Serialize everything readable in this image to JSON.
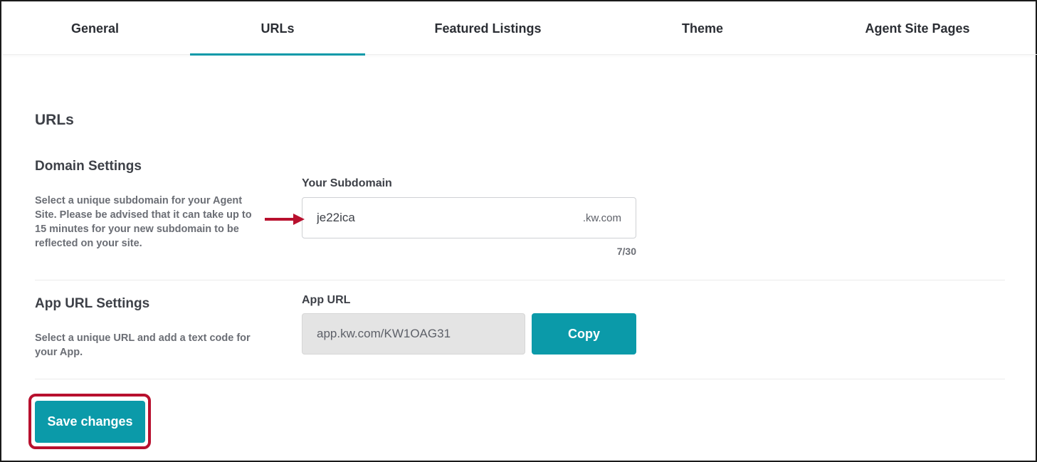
{
  "tabs": [
    {
      "label": "General",
      "active": false
    },
    {
      "label": "URLs",
      "active": true
    },
    {
      "label": "Featured Listings",
      "active": false
    },
    {
      "label": "Theme",
      "active": false
    },
    {
      "label": "Agent Site Pages",
      "active": false
    }
  ],
  "main": {
    "title": "URLs",
    "domain": {
      "title": "Domain Settings",
      "description": "Select a unique subdomain for your Agent Site. Please be advised that it can take up to 15 minutes for your new subdomain to be reflected on your site.",
      "field_label": "Your Subdomain",
      "value": "je22ica",
      "suffix": ".kw.com",
      "counter": "7/30"
    },
    "app_url": {
      "title": "App URL Settings",
      "description": "Select a unique URL and add a text code for your App.",
      "field_label": "App URL",
      "value": "app.kw.com/KW1OAG31",
      "copy_label": "Copy"
    },
    "save_label": "Save changes"
  },
  "colors": {
    "accent": "#0b9aa9",
    "annotation": "#b8102e",
    "readonly_bg": "#e4e4e4"
  }
}
